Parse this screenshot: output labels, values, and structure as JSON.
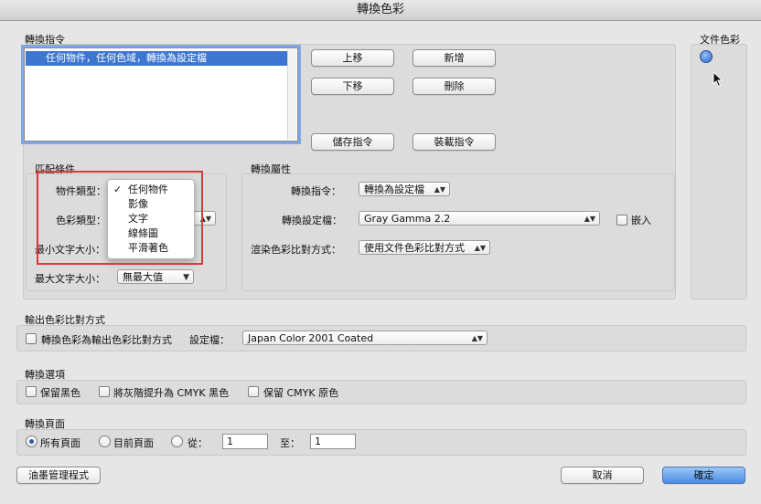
{
  "window": {
    "title": "轉換色彩"
  },
  "commands": {
    "section": "轉換指令",
    "items": [
      "任何物件，任何色域，轉換為設定檔"
    ],
    "buttons": {
      "move_up": "上移",
      "add": "新增",
      "move_down": "下移",
      "delete": "刪除",
      "save": "儲存指令",
      "load": "裝載指令"
    }
  },
  "doc_colors": {
    "section": "文件色彩"
  },
  "match": {
    "section": "匹配條件",
    "object_type_label": "物件類型：",
    "color_type_label": "色彩類型：",
    "min_text_label": "最小文字大小：",
    "max_text_label": "最大文字大小：",
    "max_text_value": "無最大值",
    "object_type_menu": [
      "任何物件",
      "影像",
      "文字",
      "線條圖",
      "平滑著色"
    ],
    "object_type_selected": "任何物件"
  },
  "conversion": {
    "section": "轉換屬性",
    "command_label": "轉換指令：",
    "command_value": "轉換為設定檔",
    "profile_label": "轉換設定檔：",
    "profile_value": "Gray Gamma 2.2",
    "embed_label": "嵌入",
    "intent_label": "渲染色彩比對方式：",
    "intent_value": "使用文件色彩比對方式"
  },
  "output_intent": {
    "section": "輸出色彩比對方式",
    "convert_label": "轉換色彩為輸出色彩比對方式",
    "profile_label": "設定檔：",
    "profile_value": "Japan Color 2001 Coated"
  },
  "options": {
    "section": "轉換選項",
    "keep_black": "保留黑色",
    "promote_gray": "將灰階提升為 CMYK 黑色",
    "keep_cmyk": "保留 CMYK 原色"
  },
  "pages": {
    "section": "轉換頁面",
    "all": "所有頁面",
    "current": "目前頁面",
    "from": "從：",
    "from_value": "1",
    "to": "至：",
    "to_value": "1"
  },
  "footer": {
    "ink_manager": "油墨管理程式",
    "cancel": "取消",
    "ok": "確定"
  }
}
